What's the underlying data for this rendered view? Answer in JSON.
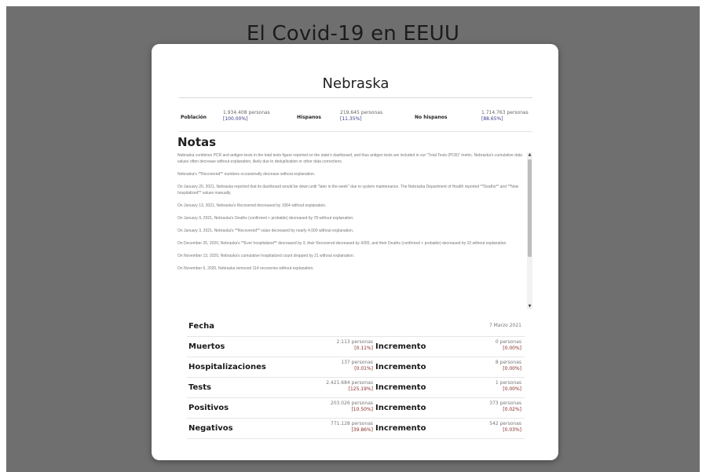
{
  "app_title": "El Covid-19 en EEUU",
  "state": "Nebraska",
  "population": {
    "poblacion_label": "Población",
    "poblacion_value": "1.934.408 personas",
    "poblacion_pct": "[100.00%]",
    "hispanos_label": "Hispanos",
    "hispanos_value": "219.645 personas",
    "hispanos_pct": "[11.35%]",
    "no_hispanos_label": "No hispanos",
    "no_hispanos_value": "1.714.763 personas",
    "no_hispanos_pct": "[88.65%]"
  },
  "notes_title": "Notas",
  "notes": [
    "Nebraska combines PCR and antigen tests in the total tests figure reported on the state's dashboard, and thus antigen tests are included in our \"Total Tests (PCR)\" metric. Nebraska's cumulative data values often decrease without explanation, likely due to deduplication or other data corrections.",
    "Nebraska's **Recovered** numbers occasionally decrease without explanation.",
    "On January 20, 2021, Nebraska reported that its dashboard would be down until \"later in the week\" due to system maintenance. The Nebraska Department of Health reported **Deaths** and **Now hospitalized** values manually.",
    "On January 13, 2021, Nebraska's Recovered decreased by 1064 without explanation.",
    "On January 9, 2021, Nebraska's Deaths (confirmed + probable) decreased by 78 without explanation.",
    "On January 3, 2021, Nebraska's **Recovered** value decreased by nearly 4,000 without explanation.",
    "On December 26, 2020, Nebraska's **Ever hospitalized** decreased by 3, their Recovered decreased by 4265, and their Deaths (confirmed + probable) decreased by 10 without explanation.",
    "On November 13, 2020, Nebraska's cumulative hospitalized count dropped by 21 without explanation.",
    "On November 6, 2020, Nebraska removed 114 recoveries without explanation."
  ],
  "stats": {
    "fecha_label": "Fecha",
    "fecha_value": "7 Marzo 2021",
    "increment_label": "Incremento",
    "rows": [
      {
        "label": "Muertos",
        "value": "2.113 personas",
        "pct": "[0.11%]",
        "inc_value": "0 personas",
        "inc_pct": "[0.00%]"
      },
      {
        "label": "Hospitalizaciones",
        "value": "137 personas",
        "pct": "[0.01%]",
        "inc_value": "8 personas",
        "inc_pct": "[0.00%]"
      },
      {
        "label": "Tests",
        "value": "2.421.684 personas",
        "pct": "[125.19%]",
        "inc_value": "1 personas",
        "inc_pct": "[0.00%]"
      },
      {
        "label": "Positivos",
        "value": "203.026 personas",
        "pct": "[10.50%]",
        "inc_value": "373 personas",
        "inc_pct": "[0.02%]"
      },
      {
        "label": "Negativos",
        "value": "771.128 personas",
        "pct": "[39.86%]",
        "inc_value": "542 personas",
        "inc_pct": "[0.03%]"
      }
    ]
  },
  "icons": {
    "scroll_up": "arrow-up-icon",
    "scroll_down": "arrow-down-icon"
  }
}
